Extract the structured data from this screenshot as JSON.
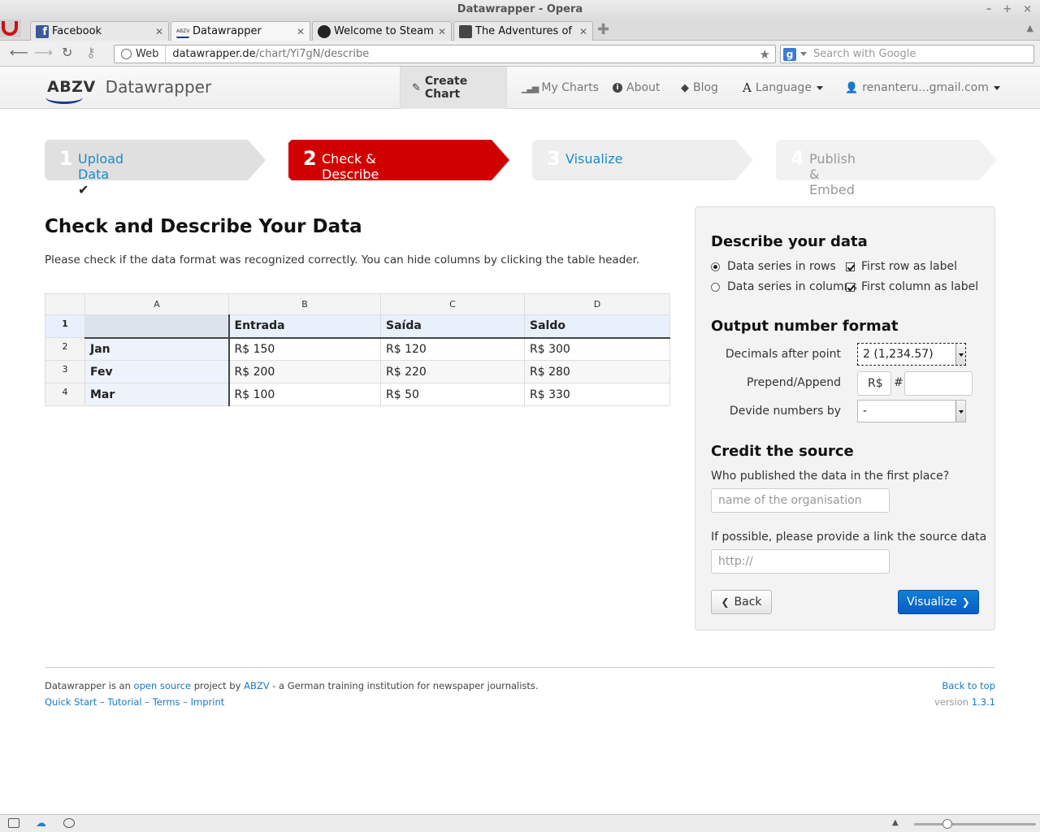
{
  "window": {
    "title": "Datawrapper - Opera"
  },
  "tabs": [
    {
      "label": "Facebook",
      "favicon_color": "#3b5998"
    },
    {
      "label": "Datawrapper",
      "favicon_color": "#ffffff"
    },
    {
      "label": "Welcome to Steam",
      "favicon_color": "#222222"
    },
    {
      "label": "The Adventures of ...",
      "favicon_color": "#444444"
    }
  ],
  "addressbar": {
    "web_label": "Web",
    "url_host": "datawrapper.de",
    "url_path": "/chart/Yi7gN/describe",
    "search_placeholder": "Search with Google"
  },
  "site": {
    "logo_mark": "ABZV",
    "logo_text": "Datawrapper",
    "nav": {
      "create_chart": "Create Chart",
      "my_charts": "My Charts",
      "about": "About",
      "blog": "Blog",
      "language": "Language",
      "user": "renanteru...gmail.com"
    }
  },
  "steps": [
    {
      "num": "1",
      "label": "Upload Data",
      "state": "done"
    },
    {
      "num": "2",
      "label": "Check & Describe",
      "state": "current"
    },
    {
      "num": "3",
      "label": "Visualize",
      "state": "next"
    },
    {
      "num": "4",
      "label": "Publish & Embed",
      "state": "disabled"
    }
  ],
  "main": {
    "heading": "Check and Describe Your Data",
    "intro": "Please check if the data format was recognized correctly. You can hide columns by clicking the table header."
  },
  "grid": {
    "col_letters": [
      "A",
      "B",
      "C",
      "D"
    ],
    "rows": [
      {
        "n": "1",
        "cells": [
          "",
          "Entrada",
          "Saída",
          "Saldo"
        ]
      },
      {
        "n": "2",
        "cells": [
          "Jan",
          "R$ 150",
          "R$ 120",
          "R$ 300"
        ]
      },
      {
        "n": "3",
        "cells": [
          "Fev",
          "R$ 200",
          "R$ 220",
          "R$ 280"
        ]
      },
      {
        "n": "4",
        "cells": [
          "Mar",
          "R$ 100",
          "R$ 50",
          "R$ 330"
        ]
      }
    ]
  },
  "sidebar": {
    "describe_title": "Describe your data",
    "rows_option": "Data series in rows",
    "columns_option": "Data series in columns",
    "first_row_label": "First row as label",
    "first_col_label": "First column as label",
    "format_title": "Output number format",
    "decimals_label": "Decimals after point",
    "decimals_value": "2 (1,234.57)",
    "prepend_label": "Prepend/Append",
    "prepend_value": "R$",
    "hash": "#",
    "append_value": "",
    "divide_label": "Devide numbers by",
    "divide_value": "-",
    "credit_title": "Credit the source",
    "publisher_q": "Who published the data in the first place?",
    "publisher_placeholder": "name of the organisation",
    "link_q": "If possible, please provide a link the source data",
    "link_placeholder": "http://",
    "back_label": "Back",
    "visualize_label": "Visualize"
  },
  "footer": {
    "t1": "Datawrapper is an ",
    "open_source": "open source",
    "t2": " project by ",
    "abzv": "ABZV",
    "t3": " - a German training institution for newspaper journalists.",
    "quick_start": "Quick Start",
    "tutorial": "Tutorial",
    "terms": "Terms",
    "imprint": "Imprint",
    "sep": " – ",
    "back_to_top": "Back to top",
    "version_label": "version ",
    "version": "1.3.1"
  }
}
